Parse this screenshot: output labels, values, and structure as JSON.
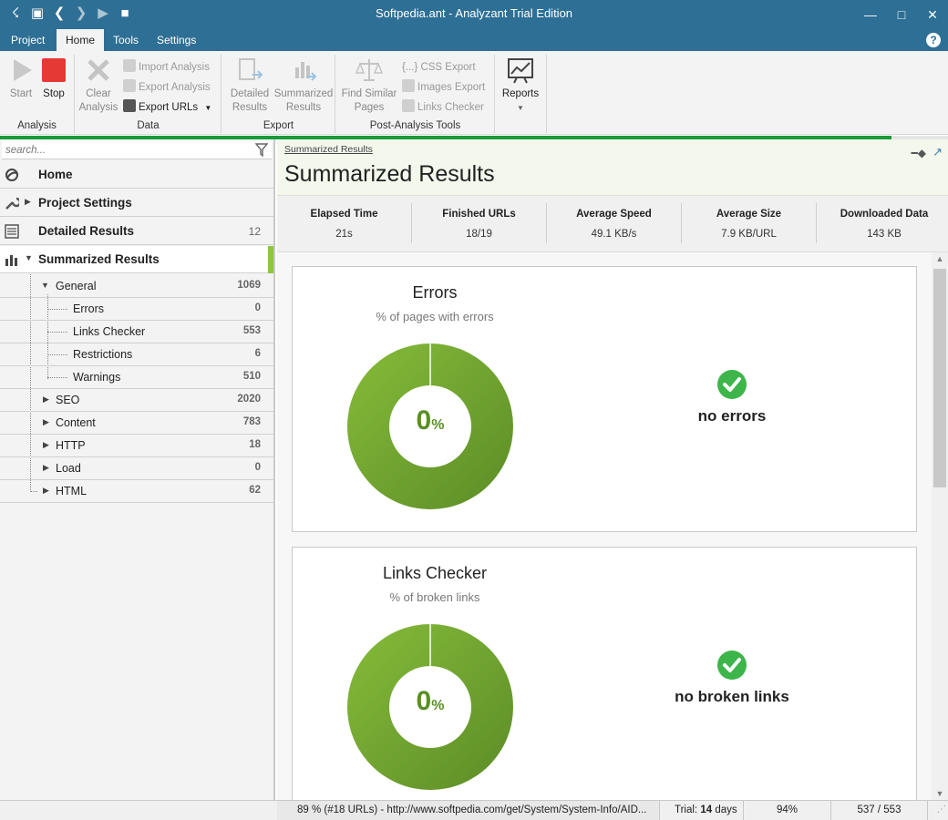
{
  "window": {
    "title": "Softpedia.ant - Analyzant Trial Edition"
  },
  "menu": {
    "tabs": [
      "Project",
      "Home",
      "Tools",
      "Settings"
    ],
    "active": "Home"
  },
  "ribbon": {
    "analysis": {
      "label": "Analysis",
      "start": "Start",
      "stop": "Stop"
    },
    "data": {
      "label": "Data",
      "clear_line1": "Clear",
      "clear_line2": "Analysis",
      "import": "Import Analysis",
      "export": "Export Analysis",
      "export_urls": "Export URLs"
    },
    "export": {
      "label": "Export",
      "detailed_line1": "Detailed",
      "detailed_line2": "Results",
      "summarized_line1": "Summarized",
      "summarized_line2": "Results"
    },
    "post": {
      "label": "Post-Analysis Tools",
      "find_line1": "Find Similar",
      "find_line2": "Pages",
      "css_export": "{...} CSS Export",
      "images_export": "Images Export",
      "links_checker": "Links Checker"
    },
    "reports": {
      "label": "Reports"
    }
  },
  "progress": {
    "fraction": 0.94
  },
  "sidebar": {
    "search_placeholder": "search...",
    "nav": [
      {
        "label": "Home",
        "count": ""
      },
      {
        "label": "Project Settings",
        "count": ""
      },
      {
        "label": "Detailed Results",
        "count": "12"
      },
      {
        "label": "Summarized Results",
        "count": ""
      }
    ],
    "tree": [
      {
        "label": "General",
        "count": "1069"
      },
      {
        "label": "Errors",
        "count": "0"
      },
      {
        "label": "Links Checker",
        "count": "553"
      },
      {
        "label": "Restrictions",
        "count": "6"
      },
      {
        "label": "Warnings",
        "count": "510"
      },
      {
        "label": "SEO",
        "count": "2020"
      },
      {
        "label": "Content",
        "count": "783"
      },
      {
        "label": "HTTP",
        "count": "18"
      },
      {
        "label": "Load",
        "count": "0"
      },
      {
        "label": "HTML",
        "count": "62"
      }
    ]
  },
  "main": {
    "breadcrumb": "Summarized Results",
    "title": "Summarized Results",
    "stats": [
      {
        "label": "Elapsed Time",
        "value": "21s"
      },
      {
        "label": "Finished URLs",
        "value": "18/19"
      },
      {
        "label": "Average Speed",
        "value": "49.1 KB/s"
      },
      {
        "label": "Average Size",
        "value": "7.9 KB/URL"
      },
      {
        "label": "Downloaded Data",
        "value": "143 KB"
      }
    ],
    "cards": [
      {
        "title": "Errors",
        "subtitle": "% of pages with errors",
        "value": "0",
        "unit": "%",
        "status": "no errors"
      },
      {
        "title": "Links Checker",
        "subtitle": "% of broken links",
        "value": "0",
        "unit": "%",
        "status": "no broken links"
      }
    ]
  },
  "statusbar": {
    "progress_text": "89 % (#18 URLs) - http://www.softpedia.com/get/System/System-Info/AID...",
    "trial_prefix": "Trial:",
    "trial_days": "14",
    "trial_suffix": "days",
    "percent": "94%",
    "count": "537 / 553"
  },
  "colors": {
    "titlebar": "#2e6f95",
    "accent_green": "#8dc63f",
    "donut_green": "#6ea32f",
    "ok_green": "#3db54a"
  }
}
